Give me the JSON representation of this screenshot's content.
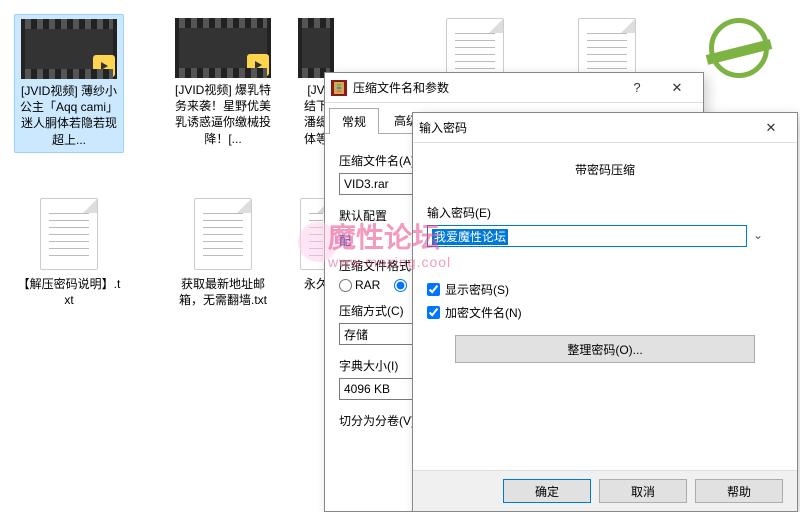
{
  "files": {
    "video1": "[JVID视频] 薄纱小公主「Aqq cami」迷人胴体若隐若现超上...",
    "video2": "[JVID视频] 爆乳特务来袭！星野优美乳诱惑逼你缴械投降！[...",
    "video3": "[JV\n结下\n潘缇\n体等",
    "txt1": "【解压密码说明】.txt",
    "txt2": "获取最新地址邮箱，无需翻墙.txt",
    "txt3": "永久"
  },
  "dialog1": {
    "title": "压缩文件名和参数",
    "tabs": {
      "general": "常规",
      "advanced": "高级"
    },
    "archive_name_label": "压缩文件名(A)",
    "archive_name_value": "VID3.rar",
    "default_profile": "默认配置",
    "profile_link": "配",
    "format_label": "压缩文件格式",
    "format_rar": "RAR",
    "method_label": "压缩方式(C)",
    "method_value": "存储",
    "dict_label": "字典大小(I)",
    "dict_value": "4096 KB",
    "split_label": "切分为分卷(V),"
  },
  "dialog2": {
    "title": "输入密码",
    "group_title": "带密码压缩",
    "password_label": "输入密码(E)",
    "password_value": "我爱魔性论坛",
    "show_password": "显示密码(S)",
    "encrypt_names": "加密文件名(N)",
    "organize": "整理密码(O)...",
    "ok": "确定",
    "cancel": "取消",
    "help": "帮助"
  },
  "watermark": {
    "text": "魔性论坛",
    "url": "www.moxing.cool"
  }
}
